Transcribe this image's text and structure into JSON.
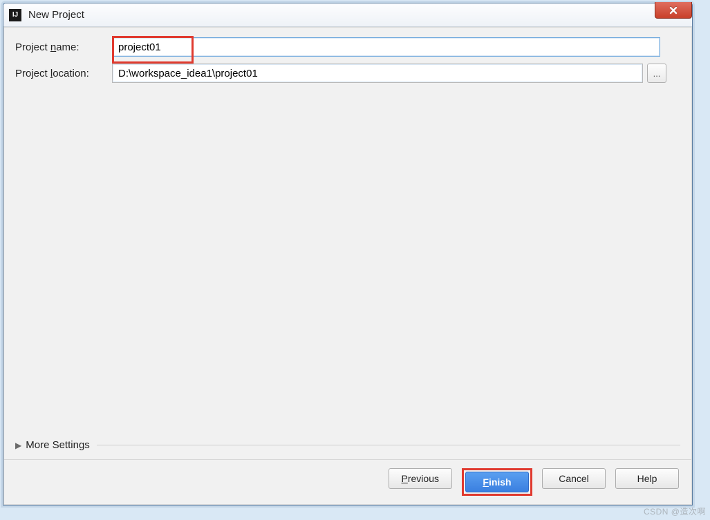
{
  "window": {
    "title": "New Project",
    "app_icon_text": "IJ"
  },
  "form": {
    "name_label_pre": "Project ",
    "name_label_mn": "n",
    "name_label_post": "ame:",
    "name_value": "project01",
    "location_label_pre": "Project ",
    "location_label_mn": "l",
    "location_label_post": "ocation:",
    "location_value": "D:\\workspace_idea1\\project01",
    "browse_label": "..."
  },
  "more": {
    "label_pre": "More ",
    "label_mn": "S",
    "label_post": "ettings"
  },
  "buttons": {
    "previous_mn": "P",
    "previous_post": "revious",
    "finish_mn": "F",
    "finish_post": "inish",
    "cancel": "Cancel",
    "help": "Help"
  },
  "watermark": "CSDN @造次啊"
}
